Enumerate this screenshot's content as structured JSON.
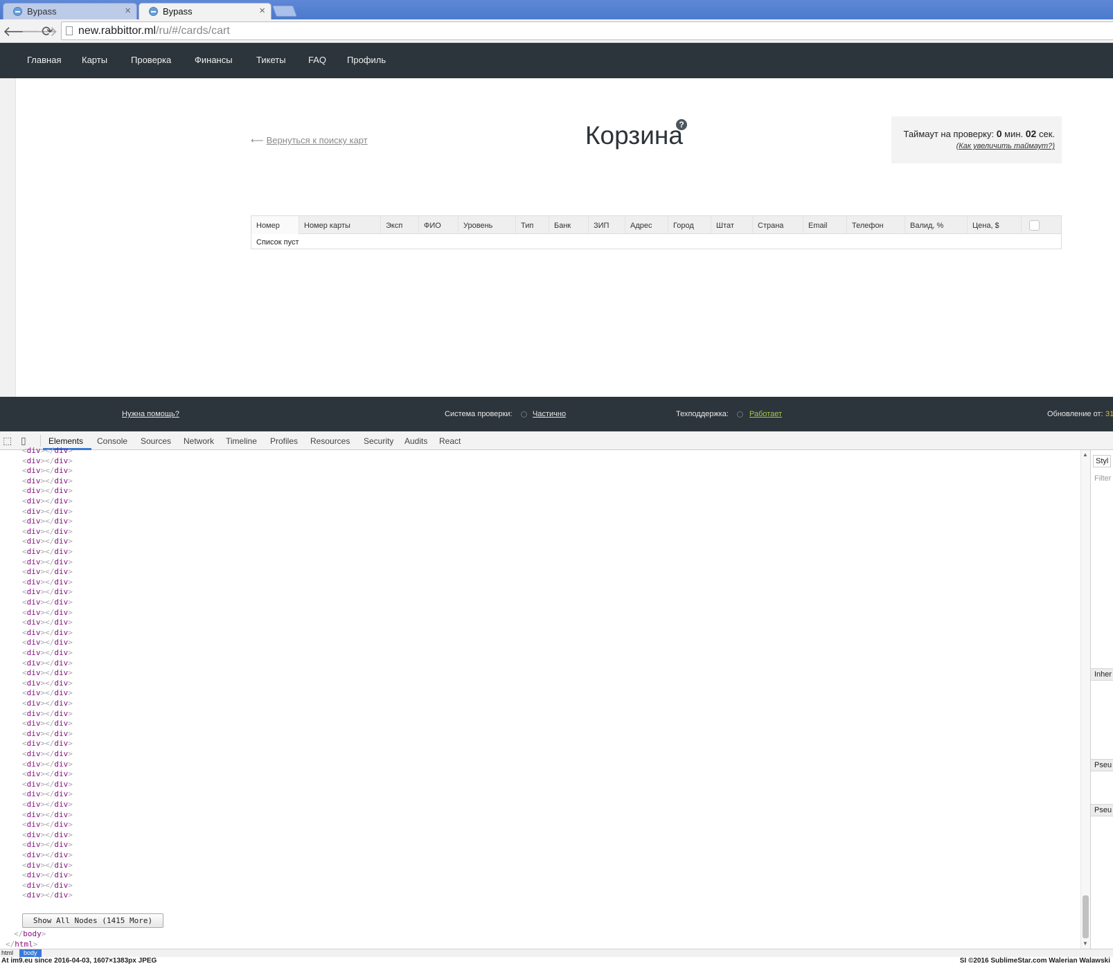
{
  "browser": {
    "tabs": [
      {
        "title": "Bypass",
        "active": false
      },
      {
        "title": "Bypass",
        "active": true
      }
    ],
    "url_host": "new.rabbittor.ml",
    "url_path": "/ru/#/cards/cart"
  },
  "nav": {
    "items": [
      "Главная",
      "Карты",
      "Проверка",
      "Финансы",
      "Тикеты",
      "FAQ",
      "Профиль"
    ]
  },
  "page": {
    "back_link": "Вернуться к поиску карт",
    "title": "Корзина",
    "help_mark": "?",
    "timeout": {
      "prefix": "Таймаут на проверку:",
      "minutes": "0",
      "min_label": "мин.",
      "seconds": "02",
      "sec_label": "сек.",
      "how_link": "(Как увеличить таймаут?)"
    },
    "table": {
      "columns": [
        "Номер",
        "Номер карты",
        "Эксп",
        "ФИО",
        "Уровень",
        "Тип",
        "Банк",
        "ЗИП",
        "Адрес",
        "Город",
        "Штат",
        "Страна",
        "Email",
        "Телефон",
        "Валид, %",
        "Цена, $"
      ],
      "empty_text": "Список пуст"
    }
  },
  "footer": {
    "help": "Нужна помощь?",
    "check_system_label": "Система проверки:",
    "check_system_status": "Частично",
    "support_label": "Техподдержка:",
    "support_status": "Работает",
    "updated_label": "Обновление от:",
    "updated_value": "31"
  },
  "devtools": {
    "tabs": [
      "Elements",
      "Console",
      "Sources",
      "Network",
      "Timeline",
      "Profiles",
      "Resources",
      "Security",
      "Audits",
      "React"
    ],
    "dom_tag": "div",
    "show_all": "Show All Nodes (1415 More)",
    "close_body": "body",
    "close_html": "html",
    "styles": {
      "tab": "Styl",
      "filter": "Filter",
      "inherited": "Inher",
      "pseudo": "Pseu"
    },
    "breadcrumbs": [
      "html",
      "body"
    ]
  },
  "caption": {
    "left": "At im9.eu since 2016-04-03, 1607×1383px JPEG",
    "right": "SI ©2016 SublimeStar.com Walerian Walawski"
  }
}
